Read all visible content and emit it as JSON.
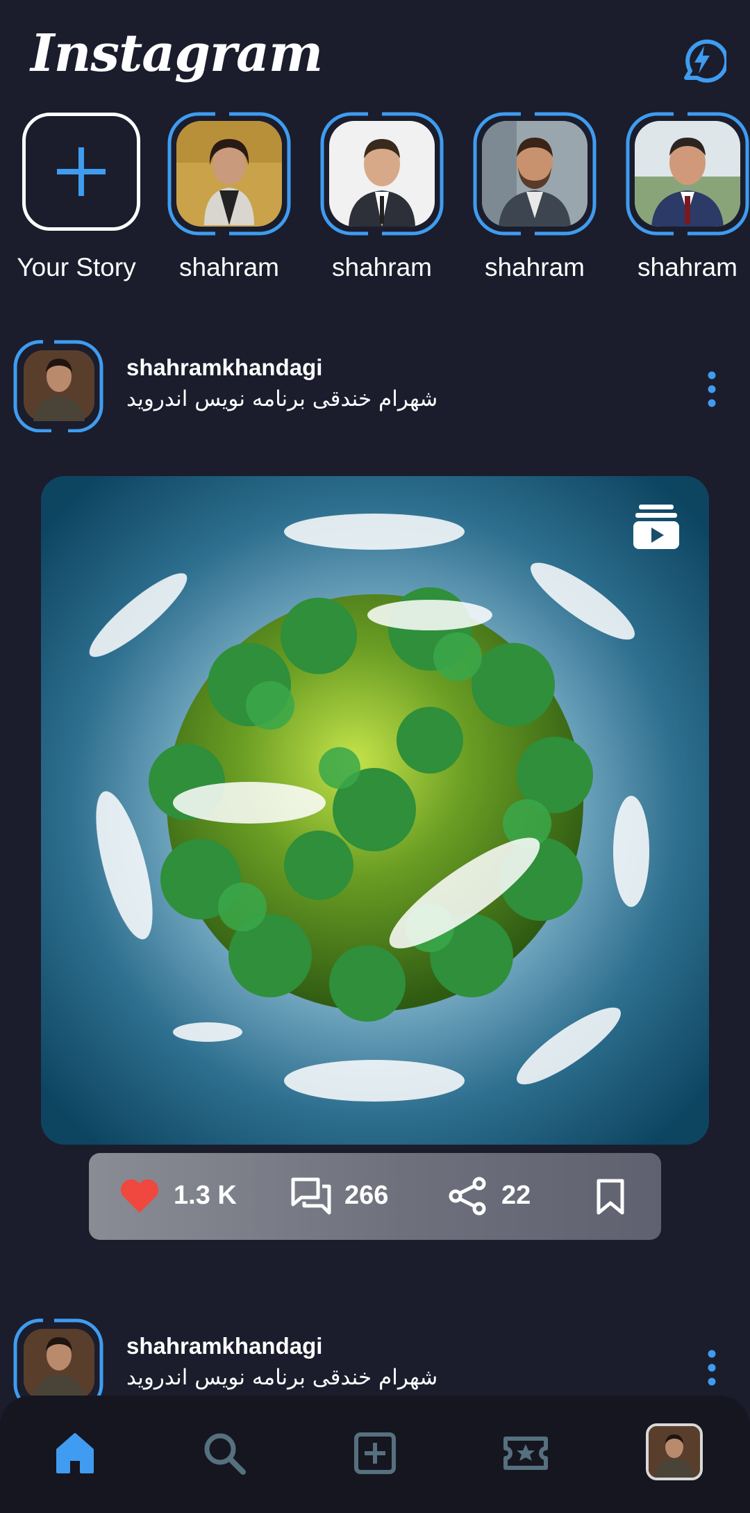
{
  "header": {
    "app_title": "Instagram",
    "activity_icon": "bolt-icon"
  },
  "stories": [
    {
      "name": "Your Story",
      "icon": "plus-icon"
    },
    {
      "name": "shahram"
    },
    {
      "name": "shahram"
    },
    {
      "name": "shahram"
    },
    {
      "name": "shahram"
    }
  ],
  "posts": [
    {
      "username": "shahramkhandagi",
      "bio": "شهرام خندقی برنامه نویس اندروید",
      "media_type_icon": "reel-icon",
      "stats": {
        "likes": "1.3 K",
        "comments": "266",
        "shares": "22"
      }
    },
    {
      "username": "shahramkhandagi",
      "bio": "شهرام خندقی برنامه نویس اندروید"
    }
  ],
  "bottom_nav": [
    "home-icon",
    "search-icon",
    "add-post-icon",
    "reels-icon",
    "profile-avatar"
  ],
  "colors": {
    "background": "#1b1d2c",
    "accent": "#3f9cf0",
    "like": "#f0473e",
    "nav_inactive": "#56707f"
  }
}
